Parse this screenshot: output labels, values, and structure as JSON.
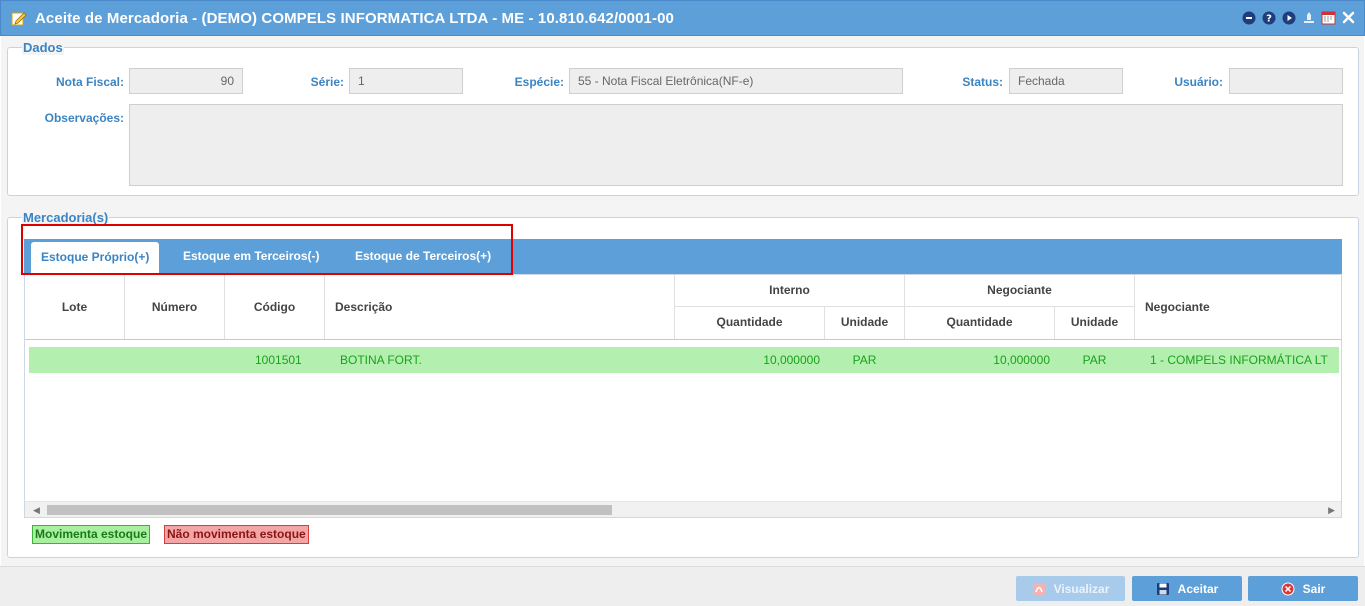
{
  "window": {
    "title": "Aceite de Mercadoria - (DEMO) COMPELS INFORMATICA LTDA - ME - 10.810.642/0001-00",
    "icons": [
      "minimize-icon",
      "help-icon",
      "play-icon",
      "user-icon",
      "calendar-icon",
      "close-icon"
    ]
  },
  "dados": {
    "legend": "Dados",
    "nota_fiscal_label": "Nota Fiscal:",
    "nota_fiscal_value": "90",
    "serie_label": "Série:",
    "serie_value": "1",
    "especie_label": "Espécie:",
    "especie_value": "55 - Nota Fiscal Eletrônica(NF-e)",
    "status_label": "Status:",
    "status_value": "Fechada",
    "usuario_label": "Usuário:",
    "usuario_value": "",
    "observacoes_label": "Observações:",
    "observacoes_value": ""
  },
  "mercadorias": {
    "legend": "Mercadoria(s)",
    "tabs": [
      {
        "label": "Estoque Próprio(+)",
        "active": true
      },
      {
        "label": "Estoque em Terceiros(-)",
        "active": false
      },
      {
        "label": "Estoque de Terceiros(+)",
        "active": false
      }
    ],
    "columns": {
      "lote": "Lote",
      "numero": "Número",
      "codigo": "Código",
      "descricao": "Descrição",
      "interno": "Interno",
      "negociante_group": "Negociante",
      "quantidade": "Quantidade",
      "unidade": "Unidade",
      "negociante": "Negociante"
    },
    "rows": [
      {
        "lote": "",
        "numero": "",
        "codigo": "1001501",
        "descricao": "BOTINA FORT.",
        "interno_quantidade": "10,000000",
        "interno_unidade": "PAR",
        "negociante_quantidade": "10,000000",
        "negociante_unidade": "PAR",
        "negociante": "1 - COMPELS INFORMÁTICA LT"
      }
    ],
    "legend_items": {
      "movimenta": "Movimenta estoque",
      "nao_movimenta": "Não movimenta estoque"
    },
    "legend_colors": {
      "movimenta_bg": "#a8f0a0",
      "nao_movimenta_bg": "#f4a6a6"
    }
  },
  "footer": {
    "visualizar": "Visualizar",
    "aceitar": "Aceitar",
    "sair": "Sair"
  },
  "colors": {
    "accent": "#5d9fd9",
    "label": "#3b84c4",
    "row_green": "#b3f0b0",
    "highlight_red": "#e00000"
  }
}
